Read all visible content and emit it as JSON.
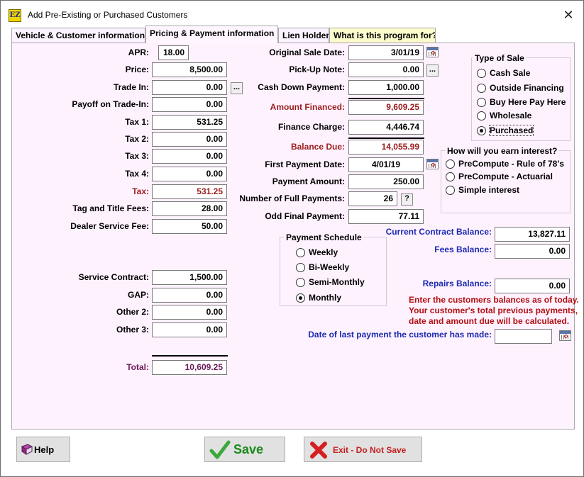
{
  "window": {
    "title": "Add Pre-Existing or Purchased Customers",
    "app_icon": "EZ"
  },
  "tabs": [
    {
      "label": "Vehicle & Customer information"
    },
    {
      "label": "Pricing & Payment information"
    },
    {
      "label": "Lien Holder"
    },
    {
      "label": "What is this program for?"
    }
  ],
  "left": {
    "apr": {
      "label": "APR:",
      "value": "18.00"
    },
    "price": {
      "label": "Price:",
      "value": "8,500.00"
    },
    "trade_in": {
      "label": "Trade In:",
      "value": "0.00",
      "btn": "..."
    },
    "payoff": {
      "label": "Payoff on Trade-In:",
      "value": "0.00"
    },
    "tax1": {
      "label": "Tax 1:",
      "value": "531.25"
    },
    "tax2": {
      "label": "Tax 2:",
      "value": "0.00"
    },
    "tax3": {
      "label": "Tax 3:",
      "value": "0.00"
    },
    "tax4": {
      "label": "Tax 4:",
      "value": "0.00"
    },
    "tax": {
      "label": "Tax:",
      "value": "531.25"
    },
    "tag_title": {
      "label": "Tag and Title Fees:",
      "value": "28.00"
    },
    "dealer_fee": {
      "label": "Dealer Service Fee:",
      "value": "50.00"
    },
    "service_contract": {
      "label": "Service Contract:",
      "value": "1,500.00"
    },
    "gap": {
      "label": "GAP:",
      "value": "0.00"
    },
    "other2": {
      "label": "Other 2:",
      "value": "0.00"
    },
    "other3": {
      "label": "Other 3:",
      "value": "0.00"
    },
    "total": {
      "label": "Total:",
      "value": "10,609.25"
    }
  },
  "middle": {
    "sale_date": {
      "label": "Original Sale Date:",
      "value": "3/01/19"
    },
    "pickup": {
      "label": "Pick-Up Note:",
      "value": "0.00",
      "btn": "..."
    },
    "cash_down": {
      "label": "Cash Down Payment:",
      "value": "1,000.00"
    },
    "amount_financed": {
      "label": "Amount Financed:",
      "value": "9,609.25"
    },
    "finance_charge": {
      "label": "Finance Charge:",
      "value": "4,446.74"
    },
    "balance_due": {
      "label": "Balance Due:",
      "value": "14,055.99"
    },
    "first_payment": {
      "label": "First Payment Date:",
      "value": "4/01/19"
    },
    "payment_amount": {
      "label": "Payment Amount:",
      "value": "250.00"
    },
    "num_payments": {
      "label": "Number of Full Payments:",
      "value": "26",
      "btn": "?"
    },
    "odd_final": {
      "label": "Odd Final Payment:",
      "value": "77.11"
    }
  },
  "payment_schedule": {
    "title": "Payment Schedule",
    "options": [
      "Weekly",
      "Bi-Weekly",
      "Semi-Monthly",
      "Monthly"
    ],
    "selected": "Monthly"
  },
  "type_of_sale": {
    "title": "Type of Sale",
    "options": [
      "Cash Sale",
      "Outside Financing",
      "Buy Here Pay Here",
      "Wholesale",
      "Purchased"
    ],
    "selected": "Purchased"
  },
  "interest": {
    "title": "How will you earn interest?",
    "options": [
      "PreCompute - Rule of 78's",
      "PreCompute - Actuarial",
      "Simple interest"
    ]
  },
  "right": {
    "current_balance": {
      "label": "Current Contract Balance:",
      "value": "13,827.11"
    },
    "fees_balance": {
      "label": "Fees Balance:",
      "value": "0.00"
    },
    "repairs_balance": {
      "label": "Repairs Balance:",
      "value": "0.00"
    },
    "note": [
      "Enter the customers balances as of today.",
      "Your customer's total previous payments,",
      "date and amount due will be calculated."
    ],
    "last_payment": {
      "label": "Date of last payment the customer has made:",
      "value": ""
    }
  },
  "buttons": {
    "help": "Help",
    "save": "Save",
    "exit": "Exit - Do Not Save"
  },
  "colors": {
    "panel_bg": "#fff2ff",
    "label_red": "#9a1c1c",
    "label_blue": "#1a2ab0",
    "note_red": "#b01010",
    "save_check": "#3aa83a",
    "exit_x": "#d42020"
  }
}
